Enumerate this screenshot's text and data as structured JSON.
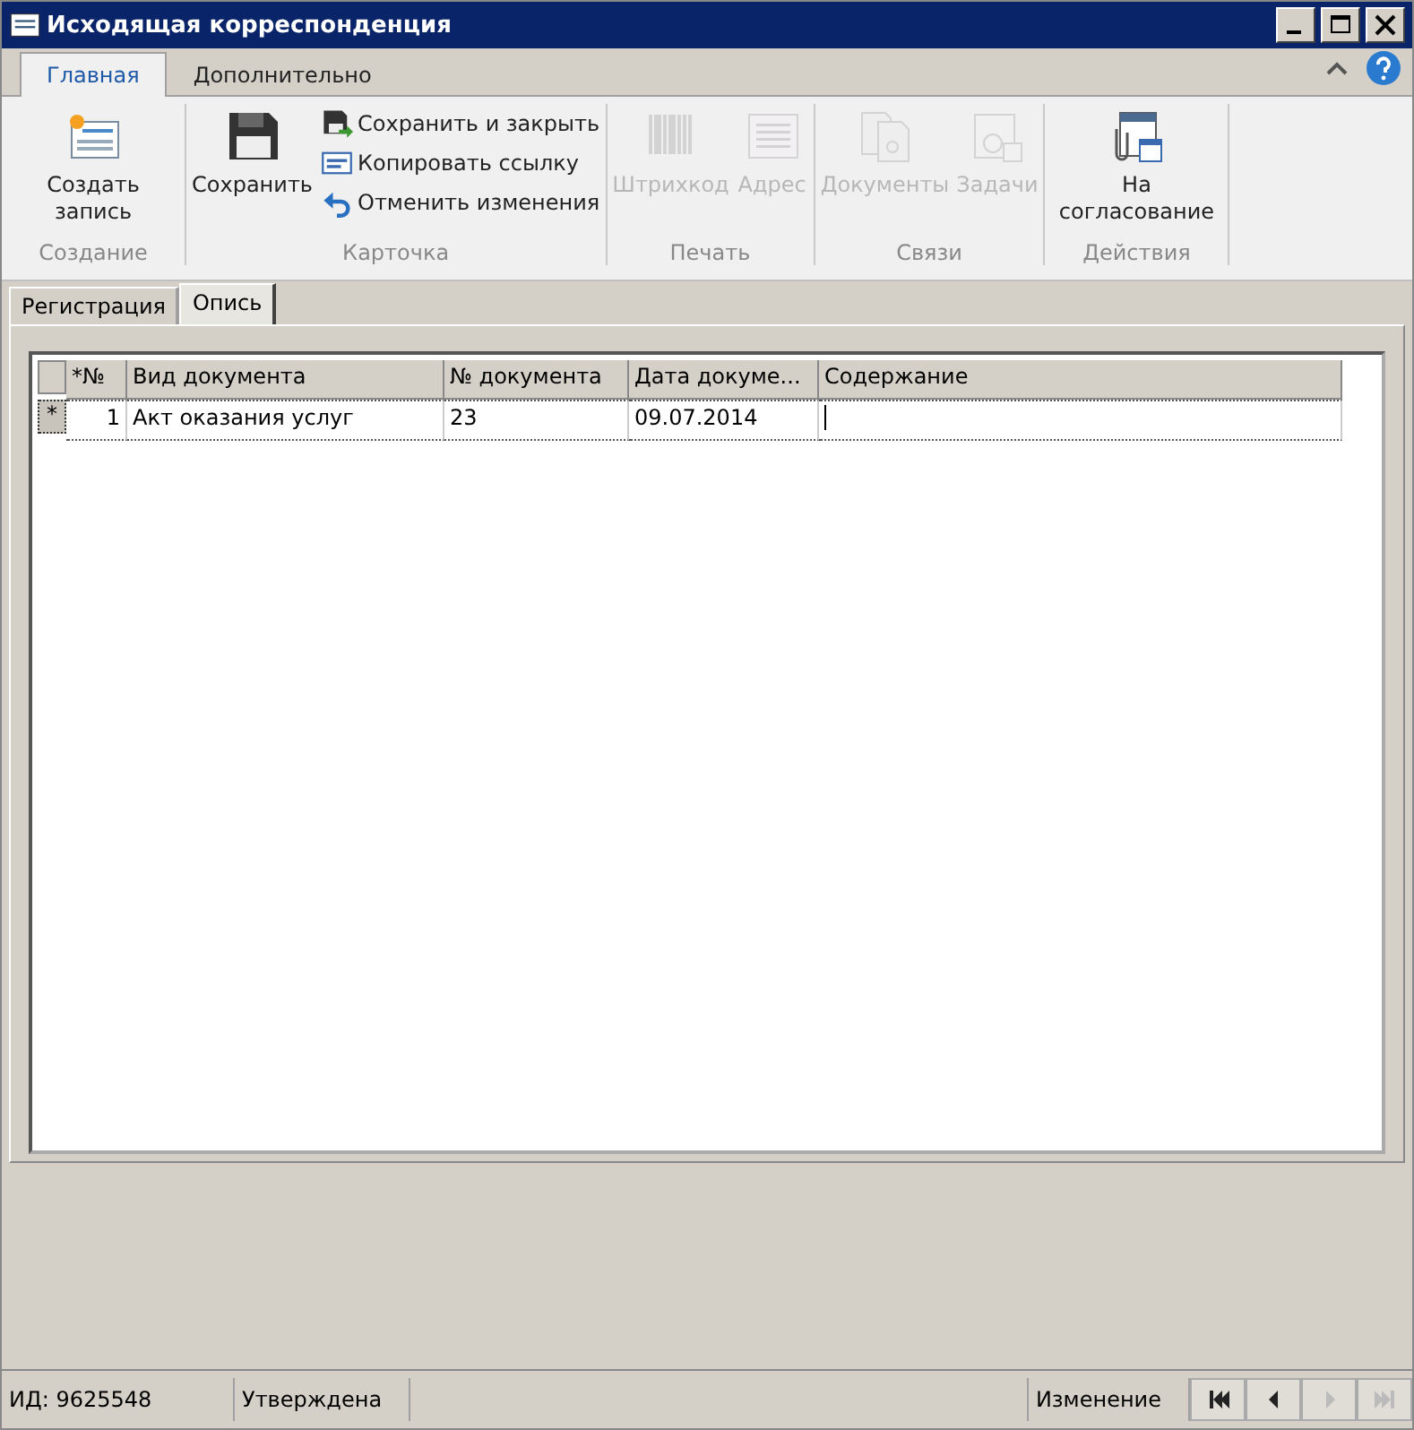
{
  "window": {
    "title": "Исходящая корреспонденция"
  },
  "ribbon_tabs": [
    {
      "label": "Главная",
      "selected": true
    },
    {
      "label": "Дополнительно",
      "selected": false
    }
  ],
  "ribbon_groups": [
    {
      "label": "Создание",
      "buttons": [
        {
          "kind": "large",
          "label": "Создать запись",
          "disabled": false
        }
      ]
    },
    {
      "label": "Карточка",
      "buttons": [
        {
          "kind": "large",
          "label": "Сохранить",
          "disabled": false
        },
        {
          "kind": "small",
          "label": "Сохранить и закрыть",
          "disabled": false
        },
        {
          "kind": "small",
          "label": "Копировать ссылку",
          "disabled": false
        },
        {
          "kind": "small",
          "label": "Отменить изменения",
          "disabled": false
        }
      ]
    },
    {
      "label": "Печать",
      "buttons": [
        {
          "kind": "large",
          "label": "Штрихкод",
          "disabled": true
        },
        {
          "kind": "large",
          "label": "Адрес",
          "disabled": true
        }
      ]
    },
    {
      "label": "Связи",
      "buttons": [
        {
          "kind": "large",
          "label": "Документы",
          "disabled": true
        },
        {
          "kind": "large",
          "label": "Задачи",
          "disabled": true
        }
      ]
    },
    {
      "label": "Действия",
      "buttons": [
        {
          "kind": "large",
          "label": "На согласование",
          "disabled": false
        }
      ]
    }
  ],
  "doc_tabs": [
    {
      "label": "Регистрация",
      "selected": false
    },
    {
      "label": "Опись",
      "selected": true
    }
  ],
  "grid": {
    "columns": [
      "*№",
      "Вид документа",
      "№ документа",
      "Дата докуме...",
      "Содержание"
    ],
    "rows": [
      {
        "indicator": "*",
        "selected": true,
        "cells": [
          "1",
          "Акт оказания услуг",
          "23",
          "09.07.2014",
          ""
        ]
      }
    ]
  },
  "status_bar": {
    "fields": [
      "ИД: 9625548",
      "Утверждена",
      "Изменение"
    ],
    "nav": [
      {
        "disabled": false
      },
      {
        "disabled": false
      },
      {
        "disabled": true
      },
      {
        "disabled": true
      }
    ]
  }
}
